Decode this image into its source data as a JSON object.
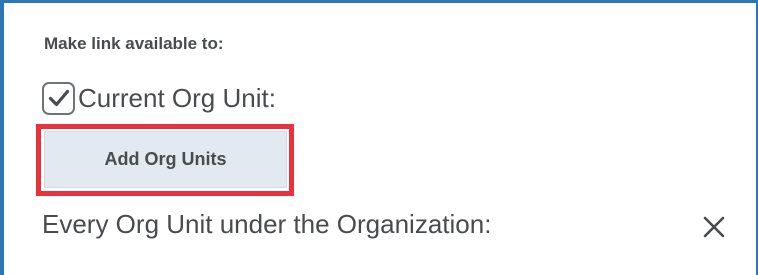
{
  "section_label": "Make link available to:",
  "current_org_unit": {
    "label": "Current Org Unit:",
    "checked": true,
    "icon": "checkmark-icon"
  },
  "add_org_units_button": {
    "label": "Add Org Units",
    "highlight_color": "#e8323c"
  },
  "every_org_unit": {
    "label": "Every Org Unit under the Organization:",
    "remove_icon": "close-icon"
  },
  "colors": {
    "frame_border": "#2a77b6",
    "text": "#494c4e",
    "button_bg": "#e3e9f1"
  }
}
